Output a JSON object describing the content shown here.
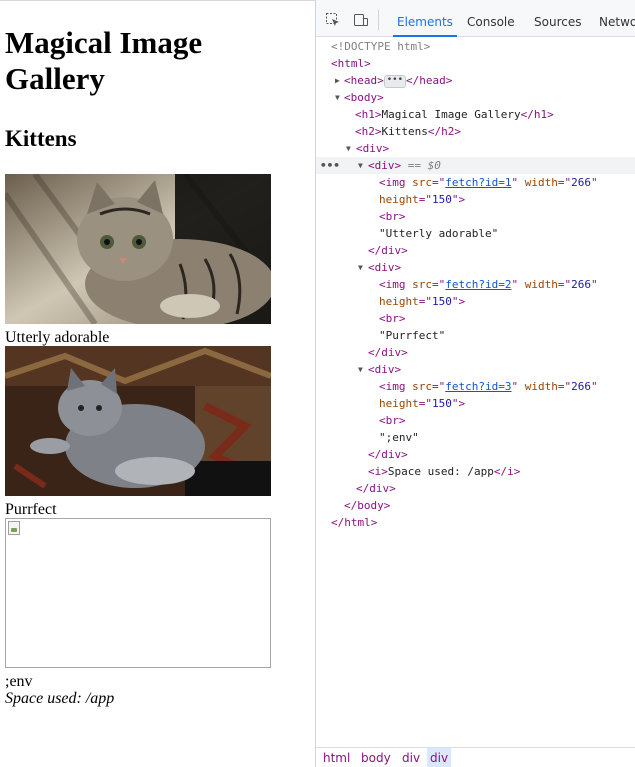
{
  "page": {
    "h1": "Magical Image Gallery",
    "h2": "Kittens",
    "images": [
      {
        "caption": "Utterly adorable",
        "description": "tabby kitten"
      },
      {
        "caption": "Purrfect",
        "description": "grey fluffy kitten"
      },
      {
        "caption": ";env",
        "description": "broken image"
      }
    ],
    "space_used": "Space used: /app"
  },
  "devtools": {
    "tabs": [
      "Elements",
      "Console",
      "Sources",
      "Network"
    ],
    "active_tab": "Elements",
    "tree": {
      "doctype": "<!DOCTYPE html>",
      "html_open": "<html>",
      "head_open": "<head>",
      "head_close": "</head>",
      "body_open": "<body>",
      "h1_text": "Magical Image Gallery",
      "h2_text": "Kittens",
      "div_selected_marker": "== $0",
      "img_srcs": [
        "fetch?id=1",
        "fetch?id=2",
        "fetch?id=3"
      ],
      "img_width": "266",
      "img_height": "150",
      "texts": [
        "\"Utterly adorable\"",
        "\"Purrfect\"",
        "\";env\""
      ],
      "i_text": "Space used: /app",
      "body_close": "</body>",
      "html_close": "</html>"
    },
    "breadcrumbs": [
      "html",
      "body",
      "div",
      "div"
    ]
  },
  "colors": {
    "tag": "#881280",
    "attr_name": "#994500",
    "attr_value": "#1a1aa6",
    "accent": "#1a73e8"
  }
}
